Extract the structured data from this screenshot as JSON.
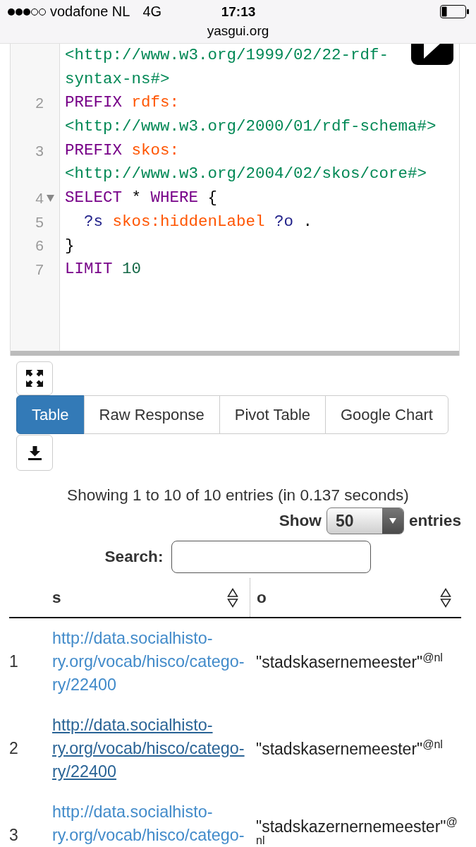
{
  "status_bar": {
    "carrier": "vodafone NL",
    "network": "4G",
    "time": "17:13",
    "url": "yasgui.org"
  },
  "editor": {
    "rows": [
      {
        "fold_marker": false,
        "tokens": [
          {
            "kind": "iri",
            "text": "<http://www.w3.org/1999/02/22-rdf-"
          }
        ]
      },
      {
        "fold_marker": false,
        "tokens": [
          {
            "kind": "iri",
            "text": "syntax-ns#>"
          }
        ]
      },
      {
        "number": "2",
        "fold_marker": false,
        "tokens": [
          {
            "kind": "keyword",
            "text": "PREFIX"
          },
          {
            "kind": "prefix",
            "text": " rdfs:"
          }
        ]
      },
      {
        "fold_marker": false,
        "tokens": [
          {
            "kind": "iri",
            "text": "<http://www.w3.org/2000/01/rdf-schema#>"
          }
        ]
      },
      {
        "number": "3",
        "fold_marker": false,
        "tokens": [
          {
            "kind": "keyword",
            "text": "PREFIX"
          },
          {
            "kind": "prefix",
            "text": " skos:"
          }
        ]
      },
      {
        "fold_marker": false,
        "tokens": [
          {
            "kind": "iri",
            "text": "<http://www.w3.org/2004/02/skos/core#>"
          }
        ]
      },
      {
        "number": "4",
        "fold_marker": true,
        "tokens": [
          {
            "kind": "keyword",
            "text": "SELECT"
          },
          {
            "kind": "punct",
            "text": " *"
          },
          {
            "kind": "keyword",
            "text": " WHERE"
          },
          {
            "kind": "punct",
            "text": " {"
          }
        ]
      },
      {
        "number": "5",
        "fold_marker": false,
        "tokens": [
          {
            "kind": "variable",
            "text": "  ?s"
          },
          {
            "kind": "prefix",
            "text": " skos:hiddenLabel"
          },
          {
            "kind": "variable",
            "text": " ?o"
          },
          {
            "kind": "punct",
            "text": " ."
          }
        ]
      },
      {
        "number": "6",
        "fold_marker": false,
        "tokens": [
          {
            "kind": "punct",
            "text": "}"
          }
        ]
      },
      {
        "number": "7",
        "fold_marker": false,
        "tokens": [
          {
            "kind": "keyword",
            "text": "LIMIT"
          },
          {
            "kind": "number",
            "text": " 10"
          }
        ]
      }
    ]
  },
  "tabs": [
    {
      "label": "Table",
      "selected": true
    },
    {
      "label": "Raw Response",
      "selected": false
    },
    {
      "label": "Pivot Table",
      "selected": false
    },
    {
      "label": "Google Chart",
      "selected": false
    }
  ],
  "results": {
    "info": "Showing 1 to 10 of 10 entries (in 0.137 seconds)",
    "length_label": "Show",
    "length_value": "50",
    "length_suffix": "entries",
    "search_label": "Search:",
    "columns": [
      "s",
      "o"
    ],
    "rows": [
      {
        "number": "1",
        "link_lines": [
          "http://data.socialhisto-",
          "ry.org/vocab/hisco/catego-",
          "ry/22400"
        ],
        "hovered": false,
        "value": "\"stadskasernemeester\"$^{@nl}$"
      },
      {
        "number": "2",
        "link_lines": [
          "http://data.socialhisto-",
          "ry.org/vocab/hisco/catego-",
          "ry/22400"
        ],
        "hovered": true,
        "value": "\"stadskasernemeester\"$^{@nl}$"
      },
      {
        "number": "3",
        "link_lines": [
          "http://data.socialhisto-",
          "ry.org/vocab/hisco/catego-"
        ],
        "hovered": false,
        "value": "\"stadskazernernemeester\"$^{@nl}$"
      }
    ]
  }
}
